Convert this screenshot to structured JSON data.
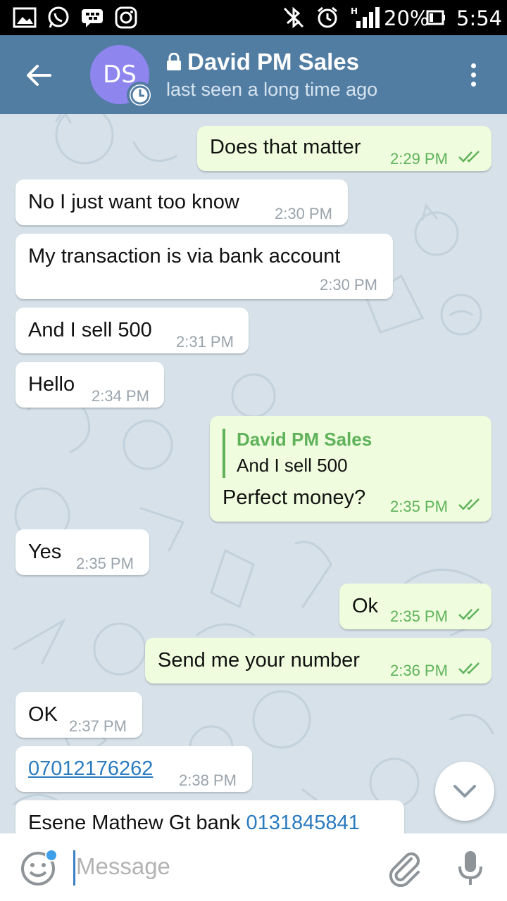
{
  "status_bar": {
    "battery": "20%",
    "time": "5:54",
    "network": "H"
  },
  "header": {
    "avatar_initials": "DS",
    "title": "David PM Sales",
    "subtitle": "last seen a long time ago"
  },
  "messages": [
    {
      "direction": "out",
      "text": "Does that matter",
      "time": "2:29 PM"
    },
    {
      "direction": "in",
      "text": "No I just want too know",
      "time": "2:30 PM"
    },
    {
      "direction": "in",
      "text": "My transaction is via bank account",
      "time": "2:30 PM"
    },
    {
      "direction": "in",
      "text": "And I sell 500",
      "time": "2:31 PM"
    },
    {
      "direction": "in",
      "text": "Hello",
      "time": "2:34 PM"
    },
    {
      "direction": "out",
      "reply_name": "David PM Sales",
      "reply_text": "And I sell 500",
      "text": "Perfect money?",
      "time": "2:35 PM"
    },
    {
      "direction": "in",
      "text": "Yes",
      "time": "2:35 PM"
    },
    {
      "direction": "out",
      "text": "Ok",
      "time": "2:35 PM"
    },
    {
      "direction": "out",
      "text": "Send me your number",
      "time": "2:36 PM"
    },
    {
      "direction": "in",
      "text": "OK",
      "time": "2:37 PM"
    },
    {
      "direction": "in",
      "text": "07012176262",
      "time": "2:38 PM"
    },
    {
      "direction": "in",
      "text": "Esene Mathew Gt bank",
      "link": "0131845841"
    }
  ],
  "input": {
    "placeholder": "Message"
  },
  "icons": {
    "back": "arrow-left-icon",
    "menu": "more-vertical-icon",
    "emoji": "smile-icon",
    "attach": "paperclip-icon",
    "mic": "microphone-icon",
    "scroll": "chevron-down-icon",
    "read": "double-check-icon"
  },
  "colors": {
    "header": "#527da3",
    "outgoing_bubble": "#effdde",
    "incoming_bubble": "#ffffff",
    "accent_green": "#5fb25a",
    "link": "#2b7bbf",
    "avatar": "#8e85ee"
  }
}
